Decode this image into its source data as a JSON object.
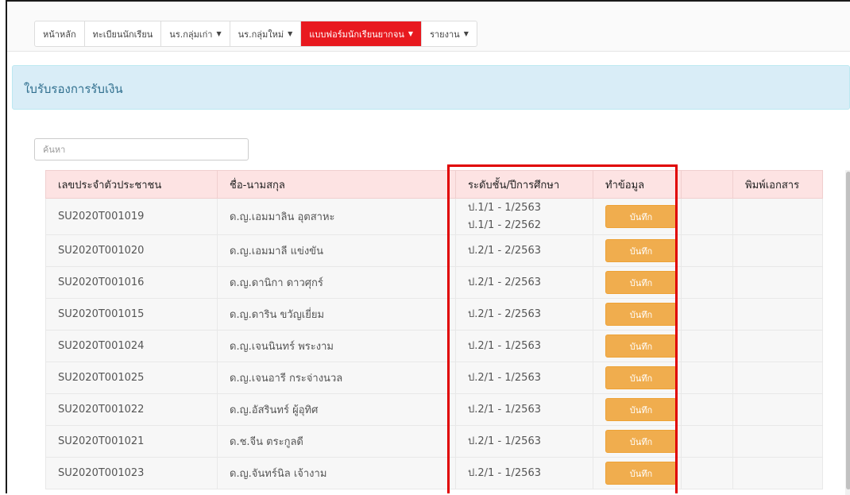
{
  "nav": {
    "items": [
      {
        "label": "หน้าหลัก",
        "dropdown": false,
        "active": false
      },
      {
        "label": "ทะเบียนนักเรียน",
        "dropdown": false,
        "active": false
      },
      {
        "label": "นร.กลุ่มเก่า",
        "dropdown": true,
        "active": false
      },
      {
        "label": "นร.กลุ่มใหม่",
        "dropdown": true,
        "active": false
      },
      {
        "label": "แบบฟอร์มนักเรียนยากจน",
        "dropdown": true,
        "active": true
      },
      {
        "label": "รายงาน",
        "dropdown": true,
        "active": false
      }
    ],
    "active_color": "#e8191f"
  },
  "page": {
    "title": "ใบรับรองการรับเงิน"
  },
  "search": {
    "placeholder": "ค้นหา",
    "value": ""
  },
  "table": {
    "columns": [
      "เลขประจำตัวประชาชน",
      "ชื่อ-นามสกุล",
      "ระดับชั้น/ปีการศึกษา",
      "ทำข้อมูล",
      "",
      "พิมพ์เอกสาร"
    ],
    "button_label": "บันทึก",
    "rows": [
      {
        "id": "SU2020T001019",
        "name": "ด.ญ.เอมมาลิน อุตสาหะ",
        "levels": [
          "ป.1/1 - 1/2563",
          "ป.1/1 - 2/2562"
        ]
      },
      {
        "id": "SU2020T001020",
        "name": "ด.ญ.เอมมาลี แข่งขัน",
        "levels": [
          "ป.2/1 - 2/2563"
        ]
      },
      {
        "id": "SU2020T001016",
        "name": "ด.ญ.ดานิกา ดาวศุกร์",
        "levels": [
          "ป.2/1 - 2/2563"
        ]
      },
      {
        "id": "SU2020T001015",
        "name": "ด.ญ.ดาริน ขวัญเยี่ยม",
        "levels": [
          "ป.2/1 - 2/2563"
        ]
      },
      {
        "id": "SU2020T001024",
        "name": "ด.ญ.เจนนินทร์ พระงาม",
        "levels": [
          "ป.2/1 - 1/2563"
        ]
      },
      {
        "id": "SU2020T001025",
        "name": "ด.ญ.เจนอารี กระจ่างนวล",
        "levels": [
          "ป.2/1 - 1/2563"
        ]
      },
      {
        "id": "SU2020T001022",
        "name": "ด.ญ.อัสรินทร์ ผู้อุทิศ",
        "levels": [
          "ป.2/1 - 1/2563"
        ]
      },
      {
        "id": "SU2020T001021",
        "name": "ด.ช.จีน ตระกูลดี",
        "levels": [
          "ป.2/1 - 1/2563"
        ]
      },
      {
        "id": "SU2020T001023",
        "name": "ด.ญ.จันทร์นิล เจ้างาม",
        "levels": [
          "ป.2/1 - 1/2563"
        ]
      }
    ]
  },
  "colors": {
    "header_bg": "#fde3e3",
    "button": "#f0ad4e",
    "alert_bg": "#d9edf7",
    "highlight_border": "#e00000"
  }
}
